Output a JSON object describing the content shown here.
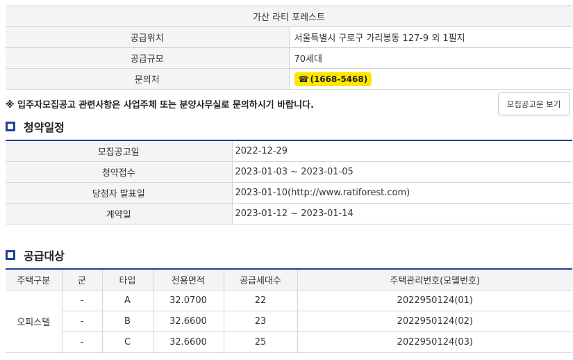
{
  "project": {
    "title": "가산 라티 포레스트",
    "location_label": "공급위치",
    "location_value": "서울특별시 구로구 가리봉동 127-9 외 1필지",
    "scale_label": "공급규모",
    "scale_value": "70세대",
    "inquiry_label": "문의처",
    "phone_icon": "☎",
    "phone": "(1668-5468)"
  },
  "notice": {
    "text": "※ 입주자모집공고 관련사항은 사업주체 또는 분양사무실로 문의하시기 바랍니다.",
    "button_label": "모집공고문 보기"
  },
  "schedule": {
    "title": "청약일정",
    "rows": [
      {
        "label": "모집공고일",
        "value": "2022-12-29"
      },
      {
        "label": "청약접수",
        "value": "2023-01-03 ~ 2023-01-05"
      },
      {
        "label": "당첨자 발표일",
        "value": "2023-01-10(http://www.ratiforest.com)"
      },
      {
        "label": "계약일",
        "value": "2023-01-12 ~ 2023-01-14"
      }
    ]
  },
  "supply": {
    "title": "공급대상",
    "headers": [
      "주택구분",
      "군",
      "타입",
      "전용면적",
      "공급세대수",
      "주택관리번호(모델번호)"
    ],
    "category": "오피스텔",
    "rows": [
      {
        "group": "-",
        "type": "A",
        "area": "32.0700",
        "units": "22",
        "mgmt_no": "2022950124(01)"
      },
      {
        "group": "-",
        "type": "B",
        "area": "32.6600",
        "units": "23",
        "mgmt_no": "2022950124(02)"
      },
      {
        "group": "-",
        "type": "C",
        "area": "32.6600",
        "units": "25",
        "mgmt_no": "2022950124(03)"
      }
    ]
  },
  "colors": {
    "accent": "#1c3f94",
    "phone_badge": "#ffe600",
    "header_bg": "#f4f4f4",
    "border": "#d5d5d5"
  },
  "icons": {
    "section": "square-bullet-icon",
    "phone": "phone-icon"
  }
}
